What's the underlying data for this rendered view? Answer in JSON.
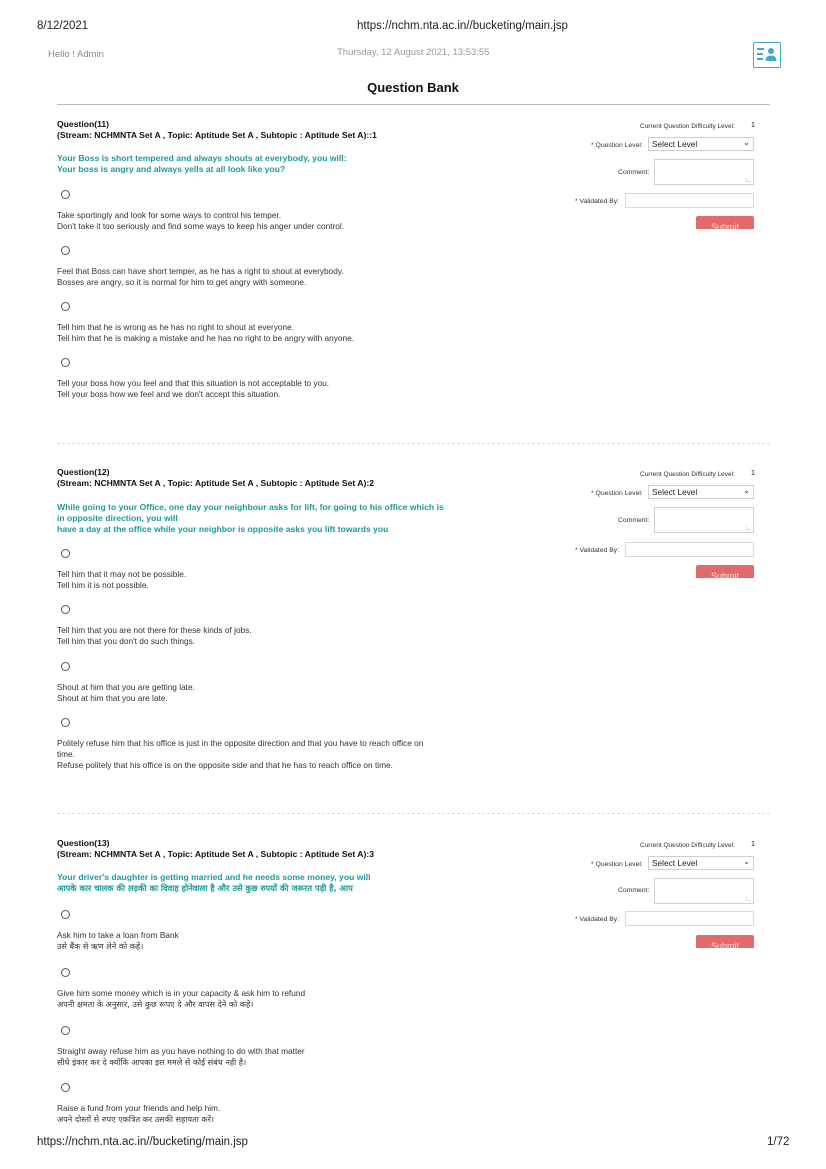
{
  "print_header": {
    "date": "8/12/2021",
    "url": "https://nchm.nta.ac.in//bucketing/main.jsp"
  },
  "print_footer": {
    "url": "https://nchm.nta.ac.in//bucketing/main.jsp",
    "page": "1/72"
  },
  "header": {
    "greeting": "Hello ! Admin",
    "datetime": "Thursday, 12 August 2021, 13:53:55",
    "user_icon": "user-card-icon",
    "accent_color": "#49a6c9"
  },
  "page_title": "Question Bank",
  "side_panel": {
    "difficulty_label": "Current Question Difficulty Level:",
    "level_label": "* Question Level:",
    "level_placeholder": "Select Level",
    "comment_label": "Comment:",
    "validated_label": "* Validated By:",
    "submit_label": "Submit",
    "submit_color": "#e26a6a"
  },
  "questions": [
    {
      "title": "Question(11)",
      "stream": "(Stream: NCHMNTA Set A , Topic: Aptitude Set A , Subtopic : Aptitude Set A)::1",
      "difficulty": "1",
      "text": [
        "Your Boss is short tempered and always shouts at everybody, you will:",
        "Your boss is angry and always yells at all look like you?"
      ],
      "options": [
        [
          "Take sportingly and look for some ways to control his temper.",
          "Don't take it too seriously and find some ways to keep his anger under control."
        ],
        [
          "Feel that Boss can have short temper, as he has a right to shout at everybody.",
          "Bosses are angry, so it is normal for him to get angry with someone."
        ],
        [
          "Tell him that he is wrong as he has no right to shout at everyone.",
          "Tell him that he is making a mistake and he has no right to be angry with anyone."
        ],
        [
          "Tell your boss how you feel and that this situation is not acceptable to you.",
          "Tell your boss how we feel and we don't accept this situation."
        ]
      ]
    },
    {
      "title": "Question(12)",
      "stream": "(Stream: NCHMNTA Set A , Topic: Aptitude Set A , Subtopic : Aptitude Set A):2",
      "difficulty": "1",
      "text": [
        "While going to your Office, one day your neighbour asks for lift, for going to his office which is",
        "in opposite direction, you will",
        "have a day at the office while your neighbor is opposite asks you lift towards you"
      ],
      "options": [
        [
          "Tell him that it may not be possible.",
          "Tell him it is not possible."
        ],
        [
          "Tell him that you are not there for these kinds of jobs.",
          "Tell him that you don't do such things."
        ],
        [
          "Shout at him that you are getting late.",
          "Shout at him that you are late."
        ],
        [
          "Politely refuse him that his office is just in the opposite direction and that you have to reach office on",
          "time.",
          "Refuse politely that his office is on the opposite side and that he has to reach office on time."
        ]
      ]
    },
    {
      "title": "Question(13)",
      "stream": "(Stream: NCHMNTA Set A , Topic: Aptitude Set A , Subtopic : Aptitude Set A):3",
      "difficulty": "1",
      "text": [
        "Your driver's daughter is getting married and he needs some money, you will",
        "आपके कार चालक की लड़की का विवाह होनेवाला है और उसे कुछ रुपयों की जरूरत पड़ी है, आप"
      ],
      "options": [
        [
          "Ask him to take a loan from Bank",
          "उसे बैंक से ऋण लेने को कहें।"
        ],
        [
          "Give him some money which is in your capacity & ask him to refund",
          "अपनी क्षमता के अनुसार, उसे कुछ रूपए दे और वापस देने को कहें।"
        ],
        [
          "Straight away refuse him as you have nothing to do with that matter",
          "सीधे इंकार कर दे क्योंकि आपका इस ममले से कोई संबंध नही है।"
        ],
        [
          "Raise a fund from your friends and help him.",
          "अपने दोस्तों से रुपए एकत्रित कर उसकी सहायता करें।"
        ]
      ]
    }
  ]
}
